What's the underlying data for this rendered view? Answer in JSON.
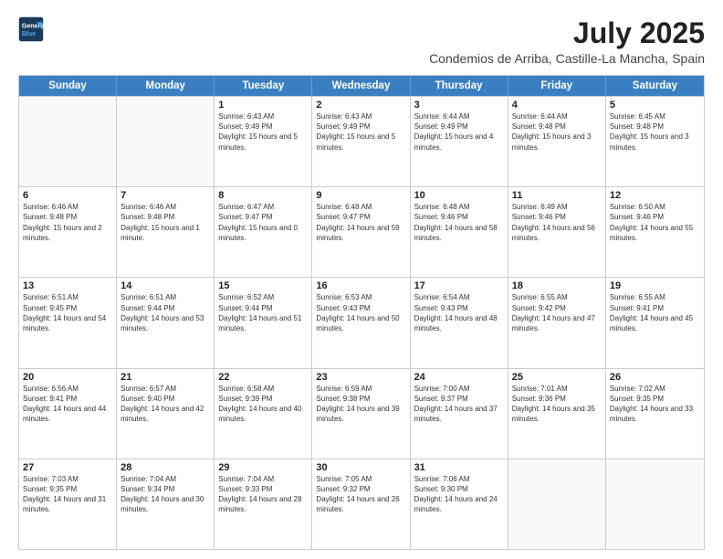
{
  "header": {
    "logo_line1": "General",
    "logo_line2": "Blue",
    "title": "July 2025",
    "subtitle": "Condemios de Arriba, Castille-La Mancha, Spain"
  },
  "calendar": {
    "days": [
      "Sunday",
      "Monday",
      "Tuesday",
      "Wednesday",
      "Thursday",
      "Friday",
      "Saturday"
    ],
    "rows": [
      [
        {
          "day": "",
          "empty": true
        },
        {
          "day": "",
          "empty": true
        },
        {
          "day": "1",
          "sunrise": "Sunrise: 6:43 AM",
          "sunset": "Sunset: 9:49 PM",
          "daylight": "Daylight: 15 hours and 5 minutes."
        },
        {
          "day": "2",
          "sunrise": "Sunrise: 6:43 AM",
          "sunset": "Sunset: 9:49 PM",
          "daylight": "Daylight: 15 hours and 5 minutes."
        },
        {
          "day": "3",
          "sunrise": "Sunrise: 6:44 AM",
          "sunset": "Sunset: 9:49 PM",
          "daylight": "Daylight: 15 hours and 4 minutes."
        },
        {
          "day": "4",
          "sunrise": "Sunrise: 6:44 AM",
          "sunset": "Sunset: 9:48 PM",
          "daylight": "Daylight: 15 hours and 3 minutes."
        },
        {
          "day": "5",
          "sunrise": "Sunrise: 6:45 AM",
          "sunset": "Sunset: 9:48 PM",
          "daylight": "Daylight: 15 hours and 3 minutes."
        }
      ],
      [
        {
          "day": "6",
          "sunrise": "Sunrise: 6:46 AM",
          "sunset": "Sunset: 9:48 PM",
          "daylight": "Daylight: 15 hours and 2 minutes."
        },
        {
          "day": "7",
          "sunrise": "Sunrise: 6:46 AM",
          "sunset": "Sunset: 9:48 PM",
          "daylight": "Daylight: 15 hours and 1 minute."
        },
        {
          "day": "8",
          "sunrise": "Sunrise: 6:47 AM",
          "sunset": "Sunset: 9:47 PM",
          "daylight": "Daylight: 15 hours and 0 minutes."
        },
        {
          "day": "9",
          "sunrise": "Sunrise: 6:48 AM",
          "sunset": "Sunset: 9:47 PM",
          "daylight": "Daylight: 14 hours and 59 minutes."
        },
        {
          "day": "10",
          "sunrise": "Sunrise: 6:48 AM",
          "sunset": "Sunset: 9:46 PM",
          "daylight": "Daylight: 14 hours and 58 minutes."
        },
        {
          "day": "11",
          "sunrise": "Sunrise: 6:49 AM",
          "sunset": "Sunset: 9:46 PM",
          "daylight": "Daylight: 14 hours and 56 minutes."
        },
        {
          "day": "12",
          "sunrise": "Sunrise: 6:50 AM",
          "sunset": "Sunset: 9:46 PM",
          "daylight": "Daylight: 14 hours and 55 minutes."
        }
      ],
      [
        {
          "day": "13",
          "sunrise": "Sunrise: 6:51 AM",
          "sunset": "Sunset: 9:45 PM",
          "daylight": "Daylight: 14 hours and 54 minutes."
        },
        {
          "day": "14",
          "sunrise": "Sunrise: 6:51 AM",
          "sunset": "Sunset: 9:44 PM",
          "daylight": "Daylight: 14 hours and 53 minutes."
        },
        {
          "day": "15",
          "sunrise": "Sunrise: 6:52 AM",
          "sunset": "Sunset: 9:44 PM",
          "daylight": "Daylight: 14 hours and 51 minutes."
        },
        {
          "day": "16",
          "sunrise": "Sunrise: 6:53 AM",
          "sunset": "Sunset: 9:43 PM",
          "daylight": "Daylight: 14 hours and 50 minutes."
        },
        {
          "day": "17",
          "sunrise": "Sunrise: 6:54 AM",
          "sunset": "Sunset: 9:43 PM",
          "daylight": "Daylight: 14 hours and 48 minutes."
        },
        {
          "day": "18",
          "sunrise": "Sunrise: 6:55 AM",
          "sunset": "Sunset: 9:42 PM",
          "daylight": "Daylight: 14 hours and 47 minutes."
        },
        {
          "day": "19",
          "sunrise": "Sunrise: 6:55 AM",
          "sunset": "Sunset: 9:41 PM",
          "daylight": "Daylight: 14 hours and 45 minutes."
        }
      ],
      [
        {
          "day": "20",
          "sunrise": "Sunrise: 6:56 AM",
          "sunset": "Sunset: 9:41 PM",
          "daylight": "Daylight: 14 hours and 44 minutes."
        },
        {
          "day": "21",
          "sunrise": "Sunrise: 6:57 AM",
          "sunset": "Sunset: 9:40 PM",
          "daylight": "Daylight: 14 hours and 42 minutes."
        },
        {
          "day": "22",
          "sunrise": "Sunrise: 6:58 AM",
          "sunset": "Sunset: 9:39 PM",
          "daylight": "Daylight: 14 hours and 40 minutes."
        },
        {
          "day": "23",
          "sunrise": "Sunrise: 6:59 AM",
          "sunset": "Sunset: 9:38 PM",
          "daylight": "Daylight: 14 hours and 39 minutes."
        },
        {
          "day": "24",
          "sunrise": "Sunrise: 7:00 AM",
          "sunset": "Sunset: 9:37 PM",
          "daylight": "Daylight: 14 hours and 37 minutes."
        },
        {
          "day": "25",
          "sunrise": "Sunrise: 7:01 AM",
          "sunset": "Sunset: 9:36 PM",
          "daylight": "Daylight: 14 hours and 35 minutes."
        },
        {
          "day": "26",
          "sunrise": "Sunrise: 7:02 AM",
          "sunset": "Sunset: 9:35 PM",
          "daylight": "Daylight: 14 hours and 33 minutes."
        }
      ],
      [
        {
          "day": "27",
          "sunrise": "Sunrise: 7:03 AM",
          "sunset": "Sunset: 9:35 PM",
          "daylight": "Daylight: 14 hours and 31 minutes."
        },
        {
          "day": "28",
          "sunrise": "Sunrise: 7:04 AM",
          "sunset": "Sunset: 9:34 PM",
          "daylight": "Daylight: 14 hours and 30 minutes."
        },
        {
          "day": "29",
          "sunrise": "Sunrise: 7:04 AM",
          "sunset": "Sunset: 9:33 PM",
          "daylight": "Daylight: 14 hours and 28 minutes."
        },
        {
          "day": "30",
          "sunrise": "Sunrise: 7:05 AM",
          "sunset": "Sunset: 9:32 PM",
          "daylight": "Daylight: 14 hours and 26 minutes."
        },
        {
          "day": "31",
          "sunrise": "Sunrise: 7:06 AM",
          "sunset": "Sunset: 9:30 PM",
          "daylight": "Daylight: 14 hours and 24 minutes."
        },
        {
          "day": "",
          "empty": true
        },
        {
          "day": "",
          "empty": true
        }
      ]
    ]
  }
}
